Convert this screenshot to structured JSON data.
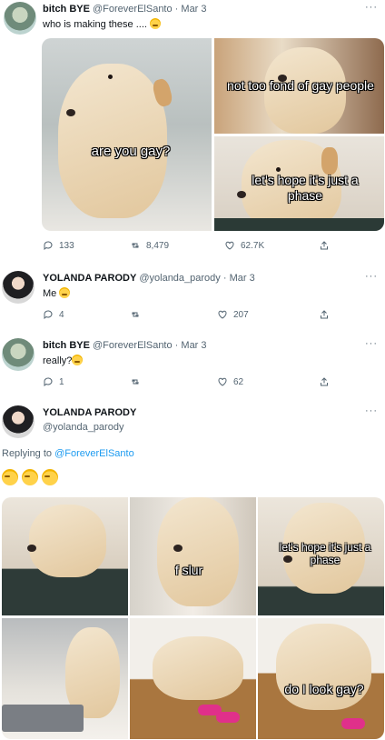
{
  "tweet1": {
    "name": "bitch BYE",
    "handle": "@ForeverElSanto",
    "sep": "·",
    "date": "Mar 3",
    "text": "who is making these ....",
    "image_captions": [
      "are you gay?",
      "not too fond of gay people",
      "let's hope it's just a phase"
    ],
    "replies": "133",
    "retweets": "8,479",
    "likes": "62.7K"
  },
  "tweet2": {
    "name": "YOLANDA PARODY",
    "handle": "@yolanda_parody",
    "sep": "·",
    "date": "Mar 3",
    "text": "Me",
    "replies": "4",
    "retweets": "",
    "likes": "207"
  },
  "tweet3": {
    "name": "bitch BYE",
    "handle": "@ForeverElSanto",
    "sep": "·",
    "date": "Mar 3",
    "text": "really?",
    "replies": "1",
    "retweets": "",
    "likes": "62"
  },
  "tweet4": {
    "name": "YOLANDA PARODY",
    "handle": "@yolanda_parody",
    "replying_label": "Replying to",
    "replying_handle": "@ForeverElSanto",
    "image_captions": [
      "f slur",
      "let's hope it's just a phase",
      "do I look gay?"
    ]
  },
  "more_glyph": "···",
  "icons": [
    "reply-icon",
    "retweet-icon",
    "like-icon",
    "share-icon",
    "more-icon",
    "crying-emoji"
  ]
}
